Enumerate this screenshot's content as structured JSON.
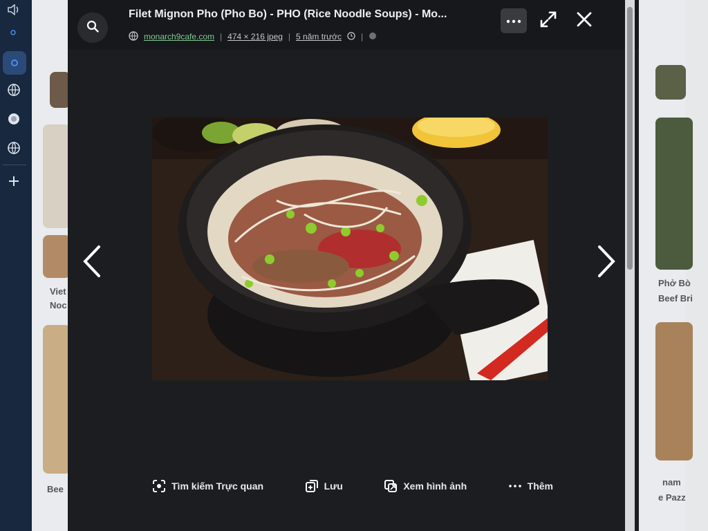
{
  "viewer": {
    "title": "Filet Mignon Pho (Pho Bo) - PHO (Rice Noodle Soups) - Mo...",
    "domain": "monarch9cafe.com",
    "dimensions": "474 × 216 jpeg",
    "age": "5 năm trước",
    "icons": {
      "search": "search-icon",
      "more": "more-horizontal-icon",
      "expand": "expand-icon",
      "close": "close-icon",
      "prev": "chevron-left-icon",
      "next": "chevron-right-icon"
    }
  },
  "actions": [
    {
      "label": "Tìm kiếm Trực quan",
      "icon": "lens-icon"
    },
    {
      "label": "Lưu",
      "icon": "bookmark-add-icon"
    },
    {
      "label": "Xem hình ảnh",
      "icon": "open-image-icon"
    },
    {
      "label": "Thêm",
      "icon": "more-icon"
    }
  ],
  "background": {
    "left_snippets": [
      "Viet",
      "Noc",
      "Bee"
    ],
    "right_snippets": [
      "Phở Bò",
      "Beef Bri",
      "nam",
      "e Pazz"
    ]
  },
  "colors": {
    "viewer_bg": "#1c1d20",
    "header_bg": "#17181b",
    "domain_green": "#81c995",
    "sidebar_bg": "#17283f"
  }
}
